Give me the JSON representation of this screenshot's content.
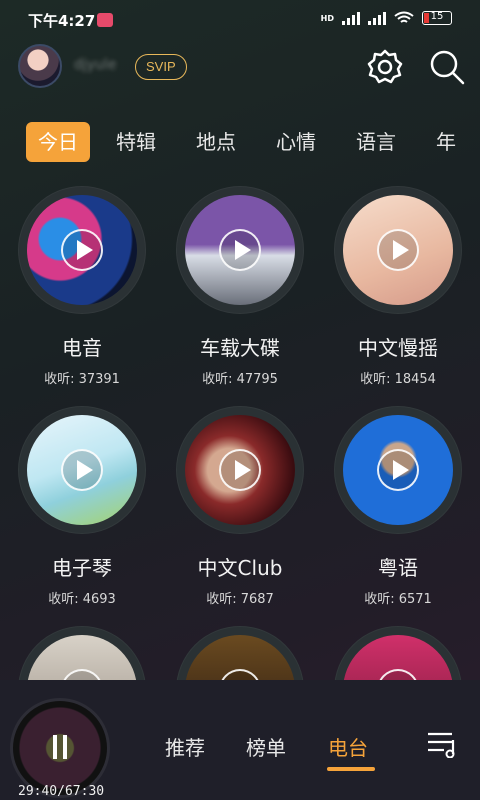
{
  "status": {
    "time": "下午4:27",
    "hd": "HD",
    "battery": "15"
  },
  "header": {
    "username": "djyule",
    "badge": "SVIP"
  },
  "tabs": [
    "今日",
    "特辑",
    "地点",
    "心情",
    "语言",
    "年"
  ],
  "stations": [
    {
      "name": "电音",
      "count_label": "收听: ",
      "count": "37391"
    },
    {
      "name": "车载大碟",
      "count_label": "收听: ",
      "count": "47795"
    },
    {
      "name": "中文慢摇",
      "count_label": "收听: ",
      "count": "18454"
    },
    {
      "name": "电子琴",
      "count_label": "收听: ",
      "count": "4693"
    },
    {
      "name": "中文Club",
      "count_label": "收听: ",
      "count": "7687"
    },
    {
      "name": "粤语",
      "count_label": "收听: ",
      "count": "6571"
    }
  ],
  "player": {
    "time": "29:40/67:30"
  },
  "bottom_nav": [
    "推荐",
    "榜单",
    "电台"
  ],
  "colors": {
    "accent": "#f5a33a",
    "svip": "#e8b85a"
  }
}
